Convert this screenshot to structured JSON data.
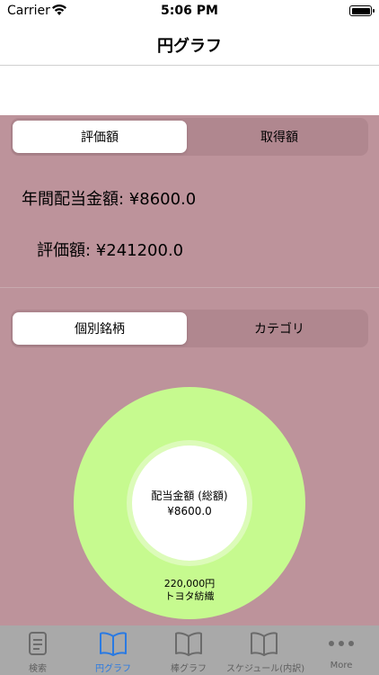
{
  "status_bar": {
    "carrier": "Carrier",
    "time": "5:06 PM"
  },
  "nav": {
    "title": "円グラフ"
  },
  "amount_segment": {
    "options": [
      "評価額",
      "取得額"
    ],
    "selected": 0
  },
  "stats": {
    "annual_dividend": "年間配当金額: ¥8600.0",
    "valuation": "評価額: ¥241200.0"
  },
  "group_segment": {
    "options": [
      "個別銘柄",
      "カテゴリ"
    ],
    "selected": 0
  },
  "chart_data": {
    "type": "pie",
    "center_text": [
      "配当金額 (総額)",
      "¥8600.0"
    ],
    "slices": [
      {
        "label": "トヨタ紡織",
        "value": 220000,
        "value_label": "220,000円",
        "color": "#c6fa8f"
      }
    ]
  },
  "tabbar": {
    "items": [
      {
        "label": "検索",
        "icon": "search-doc-icon",
        "active": false
      },
      {
        "label": "円グラフ",
        "icon": "book-icon",
        "active": true
      },
      {
        "label": "棒グラフ",
        "icon": "book-icon",
        "active": false
      },
      {
        "label": "スケジュール(内訳)",
        "icon": "book-icon",
        "active": false
      },
      {
        "label": "More",
        "icon": "more-icon",
        "active": false
      }
    ],
    "active_color": "#2a7ae2",
    "inactive_color": "#6b6b6b"
  }
}
